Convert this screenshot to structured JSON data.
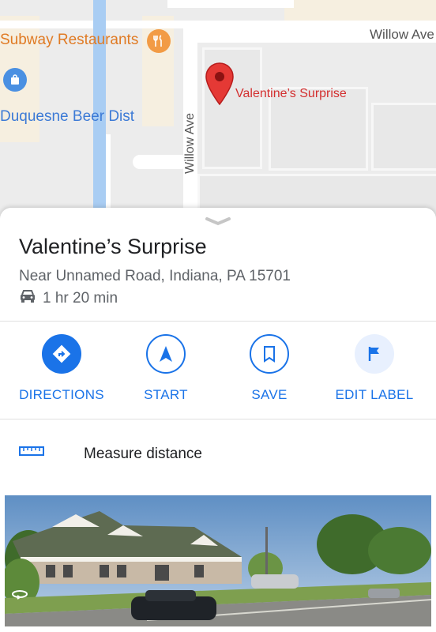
{
  "map": {
    "labels": {
      "willow_ave_top": "Willow Ave",
      "willow_ave_vertical": "Willow Ave",
      "subway": "Subway Restaurants",
      "duquesne": "Duquesne Beer Dist",
      "pin_label": "Valentine’s Surprise"
    },
    "colors": {
      "pin": "#e53935",
      "poi_orange": "#f29b45",
      "poi_blue": "#4a90e2",
      "water": "#a9cdf3"
    }
  },
  "place": {
    "name": "Valentine’s Surprise",
    "address": "Near Unnamed Road, Indiana, PA 15701",
    "drive_time": "1 hr 20 min",
    "drive_icon": "car-icon"
  },
  "actions": [
    {
      "label": "DIRECTIONS",
      "icon": "directions-icon"
    },
    {
      "label": "START",
      "icon": "navigation-arrow-icon"
    },
    {
      "label": "SAVE",
      "icon": "bookmark-icon"
    },
    {
      "label": "EDIT LABEL",
      "icon": "flag-icon"
    }
  ],
  "measure": {
    "label": "Measure distance",
    "icon": "ruler-icon"
  },
  "photo": {
    "icon": "street-view-360-icon"
  },
  "accent": "#1a73e8"
}
